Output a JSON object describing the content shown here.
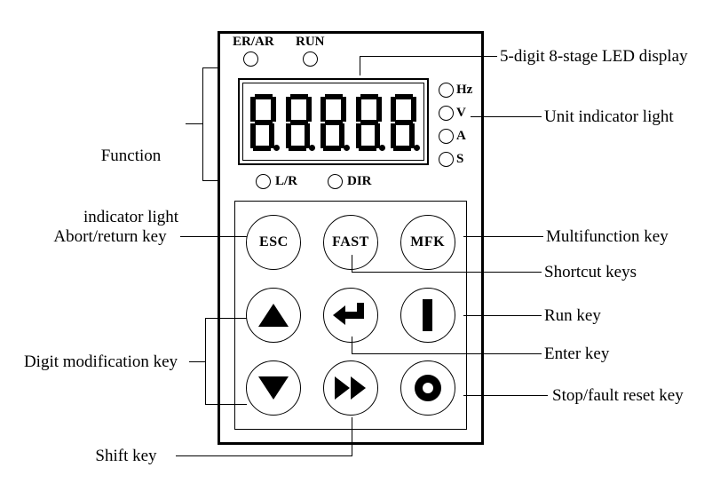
{
  "diagram": {
    "title": "Operator keypad panel diagram"
  },
  "panel": {
    "status_indicators": [
      {
        "id": "er-ar",
        "label": "ER/AR"
      },
      {
        "id": "run",
        "label": "RUN"
      }
    ],
    "display": {
      "digit_count": 5,
      "digits": [
        "8",
        "8",
        "8",
        "8",
        "8"
      ],
      "decimal_points": [
        true,
        true,
        true,
        true,
        true
      ]
    },
    "unit_indicators": [
      {
        "id": "hz",
        "label": "Hz"
      },
      {
        "id": "v",
        "label": "V"
      },
      {
        "id": "a",
        "label": "A"
      },
      {
        "id": "s",
        "label": "S"
      }
    ],
    "mode_indicators": [
      {
        "id": "lr",
        "label": "L/R"
      },
      {
        "id": "dir",
        "label": "DIR"
      }
    ],
    "keys": [
      {
        "id": "esc",
        "label": "ESC",
        "glyph": "text"
      },
      {
        "id": "fast",
        "label": "FAST",
        "glyph": "text"
      },
      {
        "id": "mfk",
        "label": "MFK",
        "glyph": "text"
      },
      {
        "id": "up",
        "label": "",
        "glyph": "triangle-up-icon"
      },
      {
        "id": "enter",
        "label": "",
        "glyph": "enter-arrow-icon"
      },
      {
        "id": "run",
        "label": "",
        "glyph": "run-bar-icon"
      },
      {
        "id": "down",
        "label": "",
        "glyph": "triangle-down-icon"
      },
      {
        "id": "shift",
        "label": "",
        "glyph": "fast-forward-icon"
      },
      {
        "id": "stop",
        "label": "",
        "glyph": "stop-ring-icon"
      }
    ]
  },
  "callouts": {
    "left": [
      {
        "id": "function-indicator-light",
        "line1": "Function",
        "line2": "indicator light"
      },
      {
        "id": "abort-return-key",
        "line1": "Abort/return key",
        "line2": ""
      },
      {
        "id": "digit-modification-key",
        "line1": "Digit modification key",
        "line2": ""
      },
      {
        "id": "shift-key",
        "line1": "Shift key",
        "line2": ""
      }
    ],
    "right": [
      {
        "id": "led-display",
        "text": "5-digit 8-stage LED display"
      },
      {
        "id": "unit-indicator",
        "text": "Unit indicator light"
      },
      {
        "id": "multifunction-key",
        "text": "Multifunction key"
      },
      {
        "id": "shortcut-keys",
        "text": "Shortcut keys"
      },
      {
        "id": "run-key",
        "text": "Run key"
      },
      {
        "id": "enter-key",
        "text": "Enter key"
      },
      {
        "id": "stop-fault-reset",
        "text": "Stop/fault reset key"
      }
    ]
  }
}
